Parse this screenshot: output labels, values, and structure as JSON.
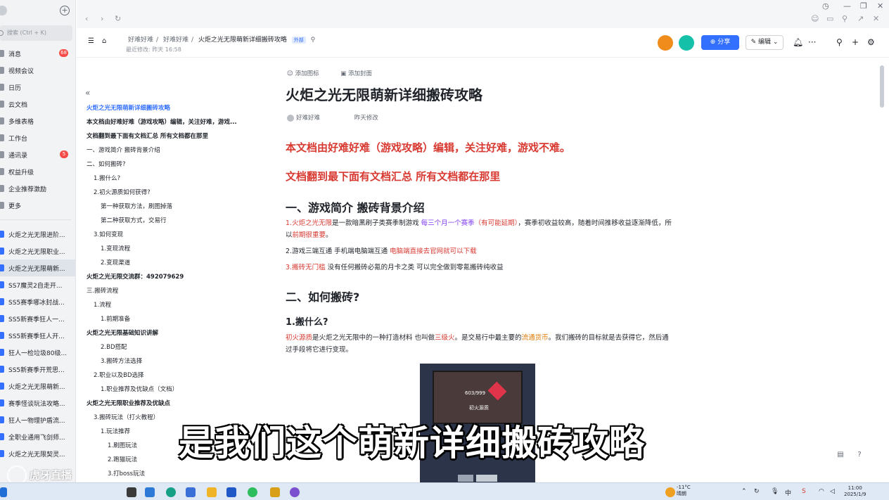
{
  "sidebar": {
    "search_placeholder": "搜索 (Ctrl + K)",
    "nav": [
      {
        "label": "消息",
        "badge": "68"
      },
      {
        "label": "视频会议",
        "badge": ""
      },
      {
        "label": "日历",
        "badge": ""
      },
      {
        "label": "云文档",
        "badge": ""
      },
      {
        "label": "多维表格",
        "badge": ""
      },
      {
        "label": "工作台",
        "badge": ""
      },
      {
        "label": "通讯录",
        "badge": "5"
      },
      {
        "label": "权益升级",
        "badge": ""
      },
      {
        "label": "企业推荐激励",
        "badge": ""
      },
      {
        "label": "更多",
        "badge": ""
      }
    ],
    "docs": [
      "火炬之光无限进阶...",
      "火炬之光无限职业...",
      "火炬之光无限萌新...",
      "SS7魔灵2自走开...",
      "SS5赛季哪冰封战...",
      "SS5新赛季狂人一...",
      "SS5新赛季狂人开...",
      "狂人一检垃圾80级...",
      "SS5新赛季开荒思...",
      "火炬之光无限萌新...",
      "赛季怪谈玩法攻略...",
      "狂人一物理护盾流...",
      "全职业通用飞剑师...",
      "火炬之光无限契灵..."
    ],
    "watermark": "虎牙直播"
  },
  "header": {
    "breadcrumbs": [
      "好难好难",
      "好难好难",
      "火炬之光无限萌新详细搬砖攻略"
    ],
    "tag": "外部",
    "last_modified": "最近修改: 昨天 16:58",
    "share_label": "分享",
    "edit_label": "编辑"
  },
  "outline": {
    "items": [
      "火炬之光无限萌新详细搬砖攻略",
      "本文档由好难好难（游戏攻略）编辑，关注好难，游戏...",
      "文档翻到最下面有文档汇总 所有文档都在那里",
      "一、游戏简介 搬砖背景介绍",
      "二、如何搬砖?",
      "1.搬什么?",
      "2.初火源质如何获得?",
      "第一种获取方法，刷图掉落",
      "第二种获取方式，交易行",
      "3.如何变现",
      "1.变现流程",
      "2.变现渠道",
      "火炬之光无限交流群：492079629",
      "三.搬砖流程",
      "1.流程",
      "1.前期准备",
      "火炬之光无限基础知识讲解",
      "2.BD搭配",
      "3.搬砖方法选择",
      "2.职业以及BD选择",
      "1.职业推荐及优缺点（文档）",
      "火炬之光无限职业推荐及优缺点",
      "3.搬砖玩法（打火教程）",
      "1.玩法推荐",
      "1.刷图玩法",
      "2.跑猫玩法",
      "3.打boss玩法"
    ]
  },
  "content": {
    "add_icon": "添加图标",
    "add_cover": "添加封面",
    "title": "火炬之光无限萌新详细搬砖攻略",
    "author": "好难好难",
    "modified": "昨天修改",
    "red_line1": "本文档由好难好难（游戏攻略）编辑，关注好难，游戏不难。",
    "red_line2": "文档翻到最下面有文档汇总 所有文档都在那里",
    "h1_intro": "一、游戏简介 搬砖背景介绍",
    "p1_a": "1.",
    "p1_b": "火炬之光无限",
    "p1_c": "是一款暗黑刷子类赛季制游戏",
    "p1_d": "每三个月一个赛季",
    "p1_e": "（有可能延期）",
    "p1_f": "，赛季初收益较高，随着时间推移收益逐渐降低，所以",
    "p1_g": "前期很重要",
    "p1_h": "。",
    "p2_a": "2.游戏三端互通 手机端电脑端互通",
    "p2_b": "电脑端直接去官网就可以下载",
    "p3_a": "3.搬砖无门槛",
    "p3_b": "没有任何搬砖必氪的月卡之类 可以完全做到零氪搬砖纯收益",
    "h1_how": "二、如何搬砖?",
    "h2_what": "1.搬什么?",
    "p4_a": "初火源质",
    "p4_b": "是火炬之光无限中的一种打造材料 也叫做",
    "p4_c": "三级火",
    "p4_d": "。是交易行中最主要的",
    "p4_e": "流通货币",
    "p4_f": "。我们搬砖的目标就是去获得它，然后通过手段将它进行变现。",
    "game_count": "603/999",
    "game_label": "初火源质"
  },
  "subtitle": "是我们这个萌新详细搬砖攻略",
  "taskbar": {
    "weather_temp": "-11°C",
    "weather_desc": "晴朗",
    "ime": "中",
    "time": "11:00",
    "date": "2025/1/9"
  },
  "colors": {
    "accent": "#3370ff",
    "red_text": "#d83931"
  }
}
